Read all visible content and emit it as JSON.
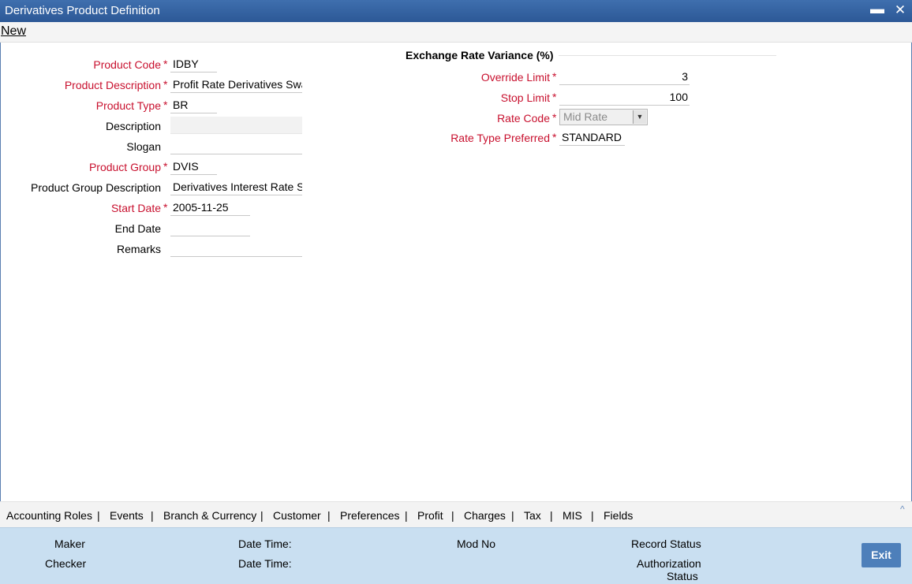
{
  "window": {
    "title": "Derivatives Product Definition",
    "minimize_label": "▬",
    "close_label": "✕"
  },
  "menu": {
    "new_label": "New"
  },
  "required_marker": "*",
  "left_fields": {
    "product_code": {
      "label": "Product Code",
      "value": "IDBY"
    },
    "product_description": {
      "label": "Product Description",
      "value": "Profit Rate Derivatives Swap"
    },
    "product_type": {
      "label": "Product Type",
      "value": "BR"
    },
    "description": {
      "label": "Description",
      "value": ""
    },
    "slogan": {
      "label": "Slogan",
      "value": ""
    },
    "product_group": {
      "label": "Product Group",
      "value": "DVIS"
    },
    "product_group_description": {
      "label": "Product Group Description",
      "value": "Derivatives Interest Rate Sw"
    },
    "start_date": {
      "label": "Start Date",
      "value": "2005-11-25"
    },
    "end_date": {
      "label": "End Date",
      "value": ""
    },
    "remarks": {
      "label": "Remarks",
      "value": ""
    }
  },
  "exchange_rate": {
    "title": "Exchange Rate Variance (%)",
    "override_limit": {
      "label": "Override Limit",
      "value": "3"
    },
    "stop_limit": {
      "label": "Stop Limit",
      "value": "100"
    },
    "rate_code": {
      "label": "Rate Code",
      "value": "Mid Rate"
    },
    "rate_type_preferred": {
      "label": "Rate Type Preferred",
      "value": "STANDARD"
    }
  },
  "tabs": [
    "Accounting Roles",
    "Events",
    "Branch & Currency",
    "Customer",
    "Preferences",
    "Profit",
    "Charges",
    "Tax",
    "MIS",
    "Fields"
  ],
  "tab_separator": "|",
  "collapse_icon": "^",
  "footer": {
    "maker": "Maker",
    "checker": "Checker",
    "date_time_1": "Date Time:",
    "date_time_2": "Date Time:",
    "mod_no": "Mod No",
    "record_status": "Record Status",
    "authorization_status_1": "Authorization",
    "authorization_status_2": "Status",
    "exit_label": "Exit"
  }
}
